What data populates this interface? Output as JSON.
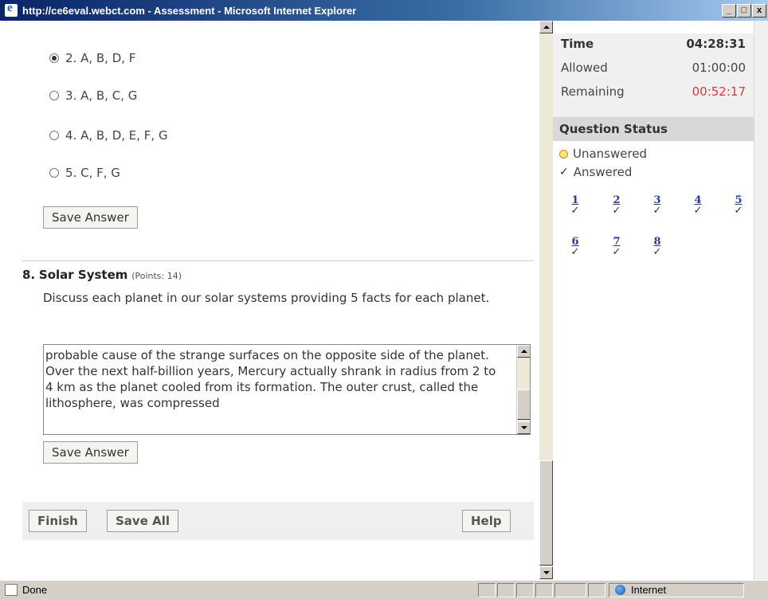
{
  "window": {
    "title": "http://ce6eval.webct.com - Assessment - Microsoft Internet Explorer",
    "minimize": "_",
    "maximize": "□",
    "close": "x"
  },
  "options": [
    {
      "label": "2. A, B, D, F",
      "checked": true
    },
    {
      "label": "3. A, B, C, G",
      "checked": false
    },
    {
      "label": "4. A, B, D, E, F, G",
      "checked": false
    },
    {
      "label": "5. C, F, G",
      "checked": false
    }
  ],
  "save_answer_1": "Save Answer",
  "question8": {
    "number": "8.",
    "title": "Solar System",
    "points": "(Points: 14)",
    "prompt": "Discuss each planet in our solar systems providing 5 facts for each planet.",
    "answer": "probable cause of the strange surfaces on the opposite side of the planet. Over the next half-billion years, Mercury actually shrank in radius from 2 to 4 km as the planet cooled from its formation. The outer crust, called the lithosphere, was compressed",
    "save_label": "Save Answer"
  },
  "footer": {
    "finish": "Finish",
    "save_all": "Save All",
    "help": "Help"
  },
  "time": {
    "label": "Time",
    "value": "04:28:31",
    "allowed_label": "Allowed",
    "allowed_value": "01:00:00",
    "remaining_label": "Remaining",
    "remaining_value": "00:52:17"
  },
  "question_status": {
    "title": "Question Status",
    "legend_unanswered": "Unanswered",
    "legend_answered": "Answered",
    "check_mark": "✓",
    "questions": [
      {
        "n": "1",
        "status": "answered"
      },
      {
        "n": "2",
        "status": "answered"
      },
      {
        "n": "3",
        "status": "answered"
      },
      {
        "n": "4",
        "status": "answered"
      },
      {
        "n": "5",
        "status": "answered"
      },
      {
        "n": "6",
        "status": "answered"
      },
      {
        "n": "7",
        "status": "answered"
      },
      {
        "n": "8",
        "status": "answered"
      }
    ]
  },
  "statusbar": {
    "text": "Done",
    "zone": "Internet"
  },
  "colors": {
    "remaining": "#d43c3c",
    "link": "#2b3a8c"
  }
}
